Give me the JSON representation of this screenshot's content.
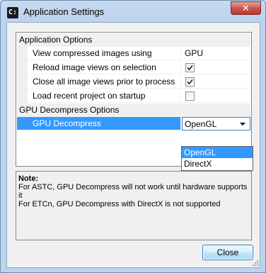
{
  "window": {
    "title": "Application Settings",
    "icon_text": "C:",
    "close_glyph": "✕"
  },
  "grid": {
    "categories": [
      "Application Options",
      "GPU Decompress Options"
    ],
    "rows": [
      {
        "label": "View compressed images using",
        "value": "GPU"
      },
      {
        "label": "Reload image views on selection",
        "checked": true
      },
      {
        "label": "Close all image views prior to process",
        "checked": true
      },
      {
        "label": "Load recent project on startup",
        "checked": false
      },
      {
        "label": "GPU Decompress",
        "value": "OpenGL",
        "selected": true
      }
    ]
  },
  "dropdown": {
    "options": [
      "OpenGL",
      "DirectX"
    ],
    "highlighted": "OpenGL"
  },
  "note": {
    "title": "Note:",
    "lines": [
      "For ASTC, GPU Decompress will not work until hardware supports it",
      "For ETCn, GPU Decompress with DirectX is not supported"
    ]
  },
  "buttons": {
    "close_label": "Close"
  },
  "colors": {
    "selection": "#3399ff",
    "title_bar": "#bcd3ee"
  }
}
